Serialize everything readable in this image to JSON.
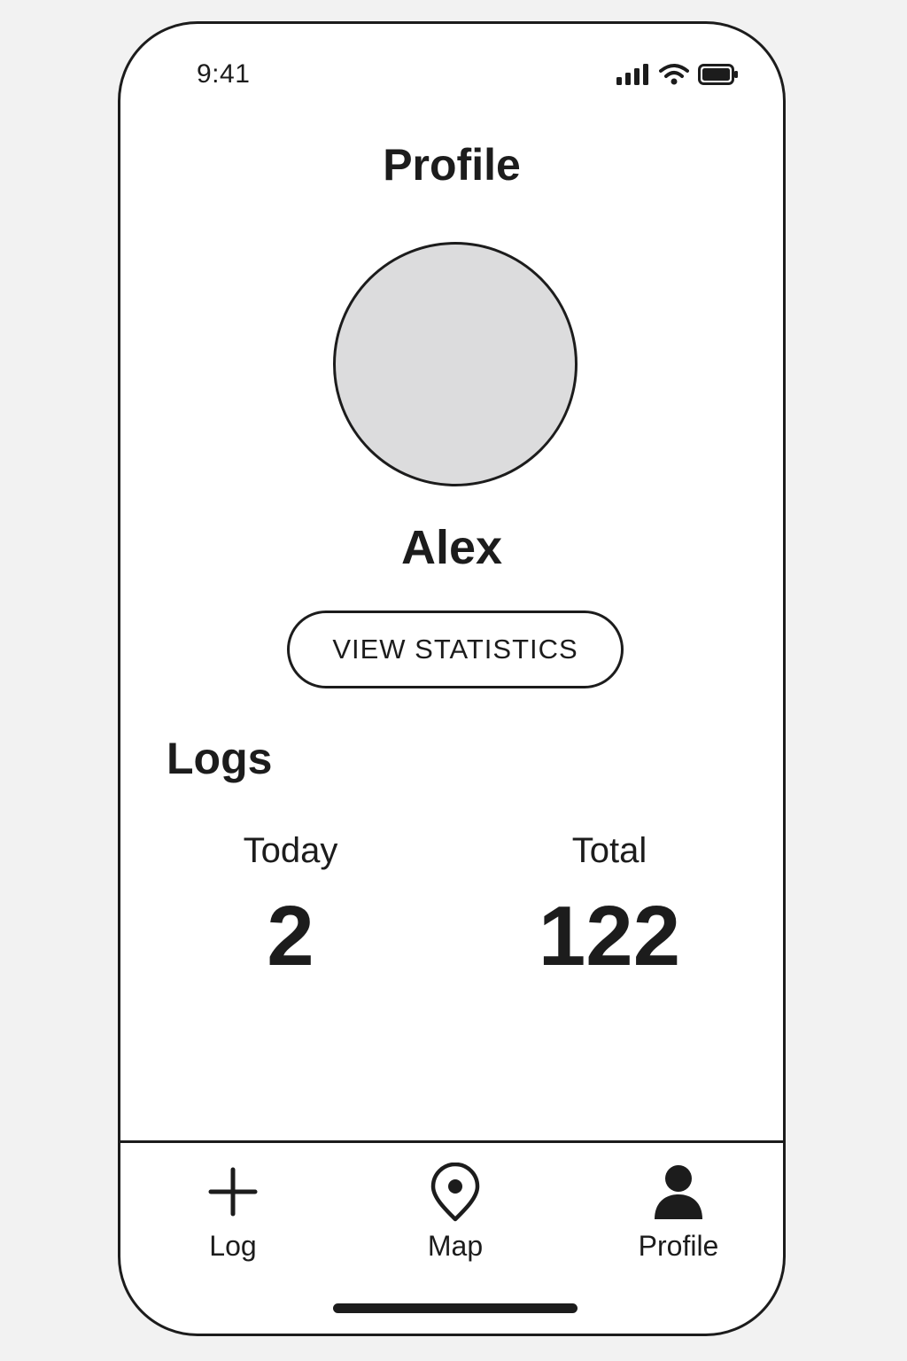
{
  "status_bar": {
    "time": "9:41",
    "icons": [
      "cellular-signal-icon",
      "wifi-icon",
      "battery-icon"
    ]
  },
  "header": {
    "title": "Profile"
  },
  "profile": {
    "name": "Alex",
    "view_statistics_label": "VIEW STATISTICS"
  },
  "logs": {
    "title": "Logs",
    "today": {
      "label": "Today",
      "value": "2"
    },
    "total": {
      "label": "Total",
      "value": "122"
    }
  },
  "tab_bar": {
    "items": [
      {
        "label": "Log",
        "icon": "plus-icon"
      },
      {
        "label": "Map",
        "icon": "map-pin-icon"
      },
      {
        "label": "Profile",
        "icon": "person-icon",
        "selected": true
      }
    ]
  },
  "colors": {
    "ink": "#1c1c1c",
    "avatar_fill": "#dcdcdd",
    "screen": "#ffffff",
    "background": "#f2f2f2"
  }
}
